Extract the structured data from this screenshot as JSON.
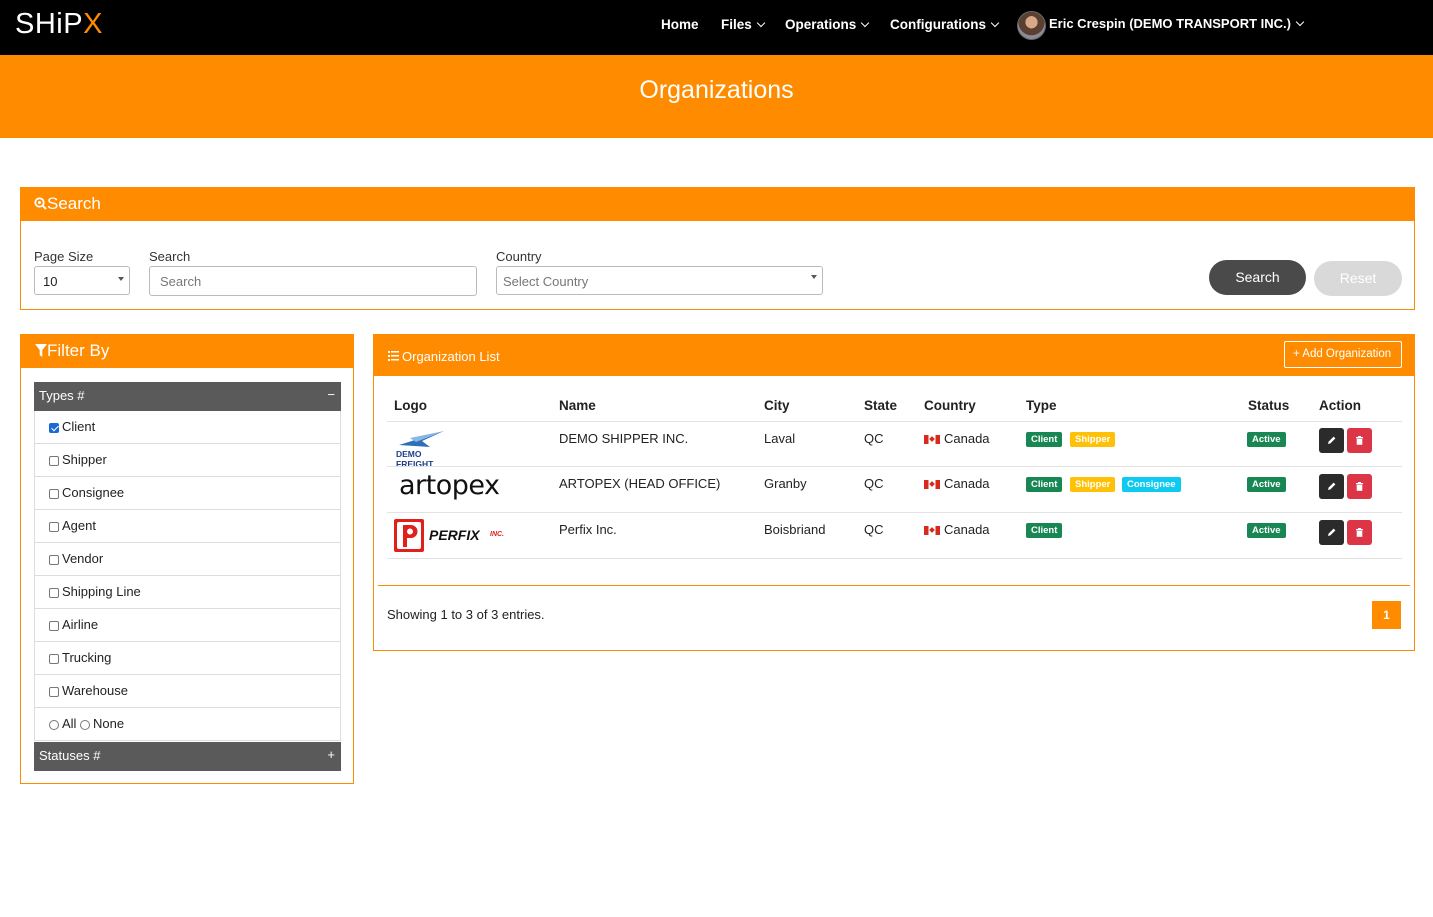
{
  "brand": {
    "logo_main": "SHiP",
    "logo_accent": "X"
  },
  "nav": {
    "home": "Home",
    "files": "Files",
    "operations": "Operations",
    "configurations": "Configurations",
    "user": "Eric Crespin (DEMO TRANSPORT INC.)"
  },
  "page": {
    "title": "Organizations"
  },
  "search": {
    "header": "Search",
    "page_size_label": "Page Size",
    "page_size_value": "10",
    "search_label": "Search",
    "search_placeholder": "Search",
    "country_label": "Country",
    "country_placeholder": "Select Country",
    "search_button": "Search",
    "reset_button": "Reset"
  },
  "filter": {
    "header": "Filter By",
    "types_title": "Types #",
    "types_toggle": "−",
    "types": [
      {
        "label": "Client",
        "checked": true
      },
      {
        "label": "Shipper",
        "checked": false
      },
      {
        "label": "Consignee",
        "checked": false
      },
      {
        "label": "Agent",
        "checked": false
      },
      {
        "label": "Vendor",
        "checked": false
      },
      {
        "label": "Shipping Line",
        "checked": false
      },
      {
        "label": "Airline",
        "checked": false
      },
      {
        "label": "Trucking",
        "checked": false
      },
      {
        "label": "Warehouse",
        "checked": false
      }
    ],
    "all_label": "All",
    "none_label": "None",
    "statuses_title": "Statuses #",
    "statuses_toggle": "+"
  },
  "list": {
    "header": "Organization List",
    "add_button": "+ Add Organization",
    "columns": [
      "Logo",
      "Name",
      "City",
      "State",
      "Country",
      "Type",
      "Status",
      "Action"
    ],
    "rows": [
      {
        "logo_text": "DEMO FREIGHT",
        "name": "DEMO SHIPPER INC.",
        "city": "Laval",
        "state": "QC",
        "country": "Canada",
        "types": [
          "Client",
          "Shipper"
        ],
        "status": "Active"
      },
      {
        "logo_text": "artopex",
        "name": "ARTOPEX (HEAD OFFICE)",
        "city": "Granby",
        "state": "QC",
        "country": "Canada",
        "types": [
          "Client",
          "Shipper",
          "Consignee"
        ],
        "status": "Active"
      },
      {
        "logo_text": "PERFIX",
        "logo_suffix": "INC.",
        "name": "Perfix Inc.",
        "city": "Boisbriand",
        "state": "QC",
        "country": "Canada",
        "types": [
          "Client"
        ],
        "status": "Active"
      }
    ],
    "summary": "Showing 1 to 3 of 3 entries.",
    "current_page": "1"
  },
  "colors": {
    "accent": "#ff8c00",
    "client": "#198754",
    "shipper": "#ffc107",
    "consignee": "#0dcaf0",
    "danger": "#dc3545"
  }
}
